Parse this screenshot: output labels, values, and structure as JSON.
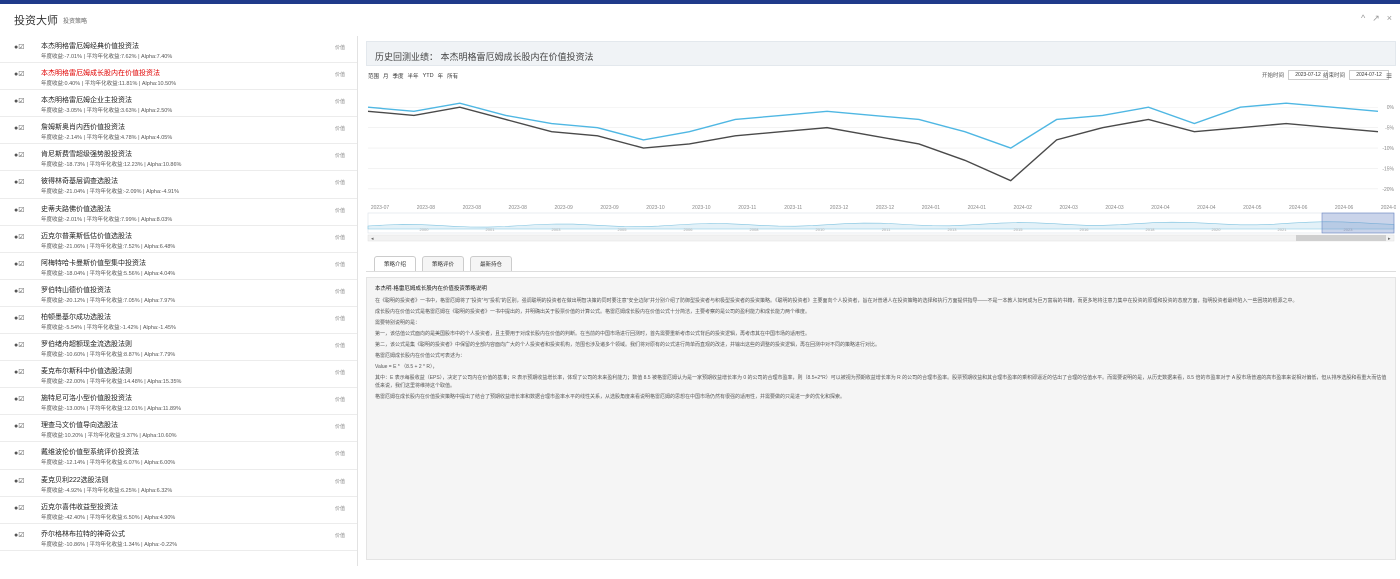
{
  "app": {
    "title": "投资大师",
    "subtitle": "投资策略"
  },
  "window_controls": [
    "^",
    "↗",
    "×"
  ],
  "sidebar": {
    "items": [
      {
        "name": "本杰明格雷厄姆经典价值投资法",
        "stats": "年度收益:-7.01% | 平均年化收益:7.62% | Alpha:7.40%",
        "badge": "价值"
      },
      {
        "name": "本杰明格雷厄姆成长股内在价值投资法",
        "stats": "年度收益:0.40% | 平均年化收益:11.81% | Alpha:10.50%",
        "badge": "价值"
      },
      {
        "name": "本杰明格雷厄姆企业主投资法",
        "stats": "年度收益:-3.05% | 平均年化收益:3.63% | Alpha:2.50%",
        "badge": "价值"
      },
      {
        "name": "詹姆斯奥肖内西价值投资法",
        "stats": "年度收益:-2.14% | 平均年化收益:4.78% | Alpha:4.05%",
        "badge": "价值"
      },
      {
        "name": "肯尼斯费雪超级强势股投资法",
        "stats": "年度收益:-18.73% | 平均年化收益:12.23% | Alpha:10.86%",
        "badge": "价值"
      },
      {
        "name": "彼得林奇基层调查选股法",
        "stats": "年度收益:-21.04% | 平均年化收益:-2.09% | Alpha:-4.91%",
        "badge": "价值"
      },
      {
        "name": "史蒂夫路佛价值选股法",
        "stats": "年度收益:-2.01% | 平均年化收益:7.99% | Alpha:8.03%",
        "badge": "价值"
      },
      {
        "name": "迈克尔普莱斯低估价值选股法",
        "stats": "年度收益:-21.06% | 平均年化收益:7.52% | Alpha:6.48%",
        "badge": "价值"
      },
      {
        "name": "阿梅特哈卡曼斯价值型集中投资法",
        "stats": "年度收益:-18.04% | 平均年化收益:5.56% | Alpha:4.04%",
        "badge": "价值"
      },
      {
        "name": "罗伯特山德价值投资法",
        "stats": "年度收益:-20.12% | 平均年化收益:7.05% | Alpha:7.97%",
        "badge": "价值"
      },
      {
        "name": "柏顿墨基尔成功选股法",
        "stats": "年度收益:-5.54% | 平均年化收益:-1.42% | Alpha:-1.45%",
        "badge": "价值"
      },
      {
        "name": "罗伯绪舟超额现金流选股法则",
        "stats": "年度收益:-10.60% | 平均年化收益:8.87% | Alpha:7.79%",
        "badge": "价值"
      },
      {
        "name": "麦克布尔斯科中价值选股法则",
        "stats": "年度收益:-22.00% | 平均年化收益:14.48% | Alpha:15.35%",
        "badge": "价值"
      },
      {
        "name": "施特尼可洛小型价值股投资法",
        "stats": "年度收益:-13.00% | 平均年化收益:12.01% | Alpha:11.89%",
        "badge": "价值"
      },
      {
        "name": "理查马文价值导向选股法",
        "stats": "年度收益:10.20% | 平均年化收益:9.37% | Alpha:10.60%",
        "badge": "价值"
      },
      {
        "name": "戴维波伦价值型系统评价投资法",
        "stats": "年度收益:-12.14% | 平均年化收益:6.07% | Alpha:6.00%",
        "badge": "价值"
      },
      {
        "name": "麦克贝利222选股法则",
        "stats": "年度收益:-4.92% | 平均年化收益:6.25% | Alpha:6.32%",
        "badge": "价值"
      },
      {
        "name": "迈克尔喜伟收益型投资法",
        "stats": "年度收益:-42.40% | 平均年化收益:6.50% | Alpha:4.90%",
        "badge": "价值"
      },
      {
        "name": "乔尔格林布拉特的神奇公式",
        "stats": "年度收益:-10.86% | 平均年化收益:1.34% | Alpha:-0.22%",
        "badge": "价值"
      }
    ]
  },
  "main": {
    "header_title": "历史回测业绩：  本杰明格雷厄姆成长股内在价值投资法",
    "range_label": "范围",
    "ranges": [
      "月",
      "季度",
      "半年",
      "YTD",
      "年",
      "所有"
    ],
    "start_label": "开始时间",
    "start_value": "2023-07-12",
    "end_label": "结束时间",
    "end_value": "2024-07-12",
    "menu_icon": "≡",
    "tabs": [
      "策略介绍",
      "策略评价",
      "最新持仓"
    ],
    "content": {
      "title": "本杰明·格雷厄姆成长股内在价值投资策略说明",
      "paragraphs": [
        "在《聪明的投资者》一书中，格雷厄姆将了“投资”与“投机”的区别，强调聪明的投资者在做出明智决策的同时要注意“安全边际”并分别介绍了防御型投资者与积极型投资者的投资策略。《聪明的投资者》主要面向个人投资者，旨在对普通人在投资策略的选择和执行方面提供指导——不是一本教人如何成为巨万富翁的书籍，而更多地将注意力集中在投资的原理和投资的态度方面，指明投资者最终陷入一些困境的根源之中。",
        "成长股内在价值公式是格雷厄姆在《聪明的投资者》一书中提出的，并明确出关于股票价值的计算公式。格雷厄姆成长股内在价值公式十分简洁，主要考察的是公司的盈利能力和成长能力两个维度。",
        "需要特别说明的是：",
        "第一，该估值公式面向的是美国股市中的个人投资者，且主要用于对成长股内在价值的判断。在当前的中国市场进行回测时，首先需要重新考虑公式背后的投资逻辑，再考虑其在中国市场的适用性。",
        "第二，该公式是集《聪明的投资者》中保留的全部内容面向广大的个人投资者和投资机构，范围也涉及诸多个领域。我们将对原有的公式进行简单而直观的改进，并输出这些的调整的投资逻辑，再在回测中对不同的策略进行对比。",
        "格雷厄姆成长股内在价值公式可表述为：",
        "Value = E * （8.5 + 2 * R），",
        "其中：E 表示每股收益（EPS），决定了公司内在价值的基准；R 表示预期收益增长率，体现了公司的未来盈利能力；数值 8.5 被格雷厄姆认为是一家预期收益增长率为 0 的公司的合理市盈率，则（8.5+2*R）可以被视为预期收益增长率为 R 的公司的合理市盈率。股票预期收益和其合理市盈率的乘积即逼近的估出了合理的估值水平。而需要说明的是，从历史数据来看，8.5 倍的市盈率对于 A 股市场普遍的高市盈率来说相对偏低，但从排序选股和看重大而估值低来说，我们这里将维持这个取值。",
        "格雷厄姆在成长股内在价值投资策略中提出了结合了预期收益增长率和数据合理市盈率水平的线性关系，从选股角度来看说明格雷厄姆的思想在中国市场仍然有很强的适用性，并需要做的只是进一步的优化和探索。"
      ]
    },
    "chart_data": {
      "type": "line",
      "title": "",
      "x": [
        "2023-07",
        "2023-08",
        "2023-08",
        "2023-08",
        "2023-09",
        "2023-09",
        "2023-10",
        "2023-10",
        "2023-11",
        "2023-11",
        "2023-12",
        "2023-12",
        "2024-01",
        "2024-01",
        "2024-02",
        "2024-03",
        "2024-03",
        "2024-04",
        "2024-04",
        "2024-05",
        "2024-06",
        "2024-06",
        "2024-07"
      ],
      "x_tick_labels": [
        "2023-07",
        "2023-08",
        "2023-08",
        "2023-08",
        "2023-09",
        "2023-09",
        "2023-10",
        "2023-10",
        "2023-11",
        "2023-11",
        "2023-12",
        "2023-12",
        "2024-01",
        "2024-01",
        "2024-02",
        "2024-03",
        "2024-03",
        "2024-04",
        "2024-04",
        "2024-05",
        "2024-06",
        "2024-06",
        "2024-07"
      ],
      "y_tick_labels": [
        "0%",
        "-5%",
        "-10%",
        "-15%",
        "-20%"
      ],
      "ylim": [
        -22,
        3
      ],
      "grid": true,
      "series": [
        {
          "color": "#4fb7e3",
          "values": [
            0,
            -1,
            1,
            -2,
            -4,
            -5,
            -8,
            -6,
            -3,
            -2,
            -1,
            -2,
            -3,
            -6,
            -10,
            -3,
            -2,
            0,
            -4,
            0,
            1,
            0,
            -1
          ]
        },
        {
          "color": "#4a4a4a",
          "values": [
            -1,
            -2,
            0,
            -3,
            -6,
            -7,
            -10,
            -9,
            -7,
            -6,
            -5,
            -7,
            -9,
            -13,
            -18,
            -8,
            -5,
            -3,
            -6,
            -5,
            -4,
            -5,
            -6
          ]
        }
      ],
      "navigator": {
        "year_labels": [
          "2000",
          "2001",
          "2003",
          "2005",
          "2006",
          "2008",
          "2010",
          "2011",
          "2013",
          "2015",
          "2016",
          "2018",
          "2020",
          "2021",
          "2023"
        ],
        "selection_label": "III"
      }
    }
  }
}
